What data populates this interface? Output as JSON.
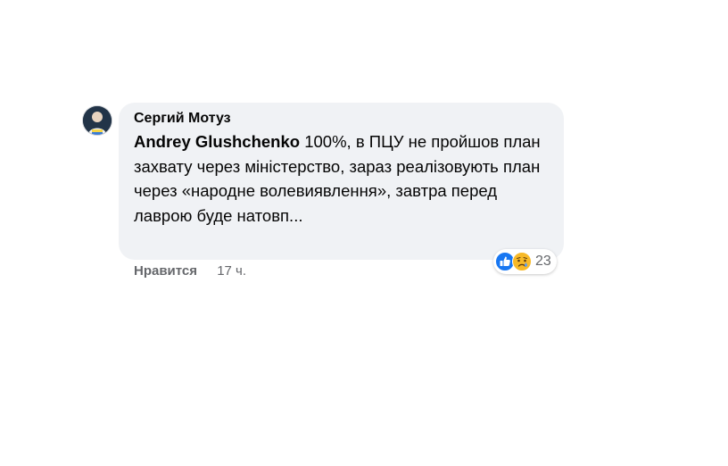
{
  "comment": {
    "author": "Сергий Мотуз",
    "mention": "Andrey Glushchenko",
    "body": " 100%, в ПЦУ не пройшов план захвату через міністерство, зараз реалізовують план через «народне волевиявлення», завтра перед лаврою буде натовп...",
    "reactions": {
      "icons": [
        "like-icon",
        "sad-icon"
      ],
      "count": "23"
    }
  },
  "actions": {
    "like_label": "Нравится",
    "time": "17 ч."
  },
  "colors": {
    "bubble": "#f0f2f5",
    "like_blue": "#1877f2",
    "secondary_text": "#65676b",
    "sad_yellow": "#f7b928"
  }
}
